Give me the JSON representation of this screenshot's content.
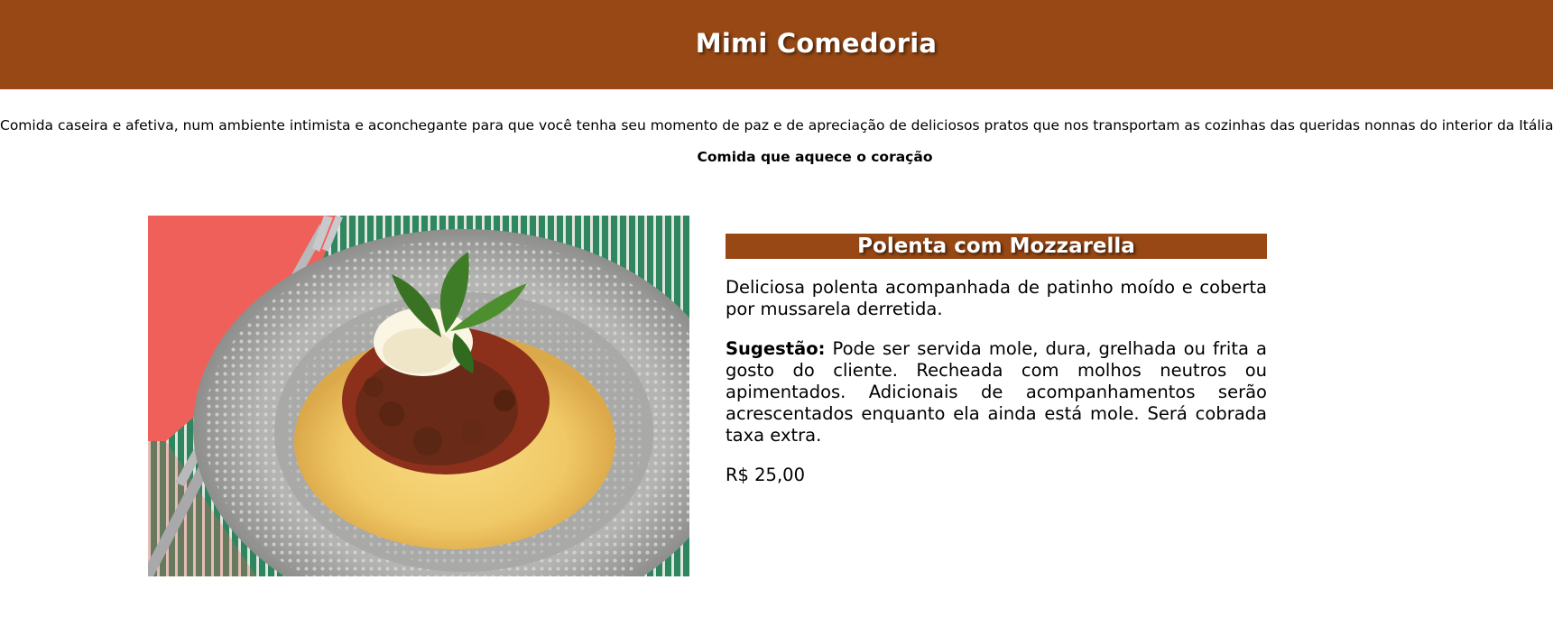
{
  "header": {
    "title": "Mimi Comedoria"
  },
  "intro": {
    "text": "Comida caseira e afetiva, num ambiente intimista e aconchegante para que você tenha seu momento de paz e de apreciação de deliciosos pratos que nos transportam as cozinhas das queridas nonnas do interior da Itália.",
    "tagline": "Comida que aquece o coração"
  },
  "dish": {
    "title": "Polenta com Mozzarella",
    "description": "Deliciosa polenta acompanhada de patinho moído e coberta por mussarela derretida.",
    "suggestion_label": "Sugestão:",
    "suggestion_text": " Pode ser servida mole, dura, grelhada ou frita a gosto do cliente. Recheada com molhos neutros ou apimentados. Adicionais de acompanhamentos serão acrescentados enquanto ela ainda está mole. Será cobrada taxa extra.",
    "price": "R$ 25,00"
  },
  "colors": {
    "brand": "#974814",
    "text": "#000000",
    "background": "#ffffff"
  }
}
